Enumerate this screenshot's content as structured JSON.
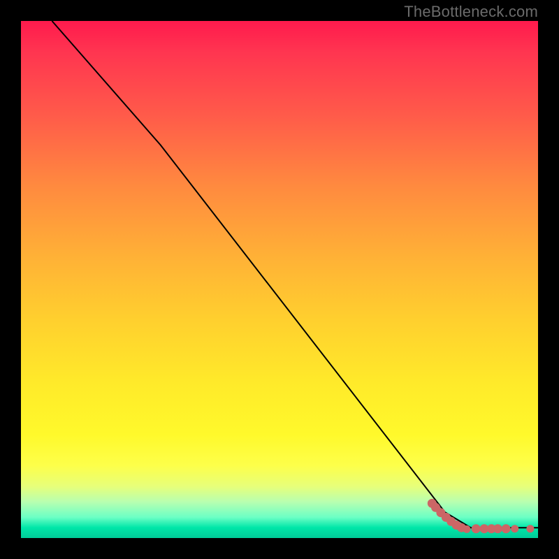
{
  "watermark": "TheBottleneck.com",
  "chart_data": {
    "type": "line",
    "title": "",
    "xlabel": "",
    "ylabel": "",
    "xlim": [
      0,
      1
    ],
    "ylim": [
      0,
      1
    ],
    "series": [
      {
        "name": "curve",
        "points": [
          {
            "x": 0.06,
            "y": 1.0
          },
          {
            "x": 0.27,
            "y": 0.76
          },
          {
            "x": 0.82,
            "y": 0.05
          },
          {
            "x": 0.87,
            "y": 0.02
          },
          {
            "x": 1.0,
            "y": 0.02
          }
        ]
      }
    ],
    "scatter": [
      {
        "x": 0.795,
        "y": 0.067,
        "r": 6
      },
      {
        "x": 0.802,
        "y": 0.059,
        "r": 6
      },
      {
        "x": 0.812,
        "y": 0.049,
        "r": 6
      },
      {
        "x": 0.822,
        "y": 0.04,
        "r": 6
      },
      {
        "x": 0.832,
        "y": 0.032,
        "r": 6
      },
      {
        "x": 0.842,
        "y": 0.025,
        "r": 6
      },
      {
        "x": 0.852,
        "y": 0.02,
        "r": 6
      },
      {
        "x": 0.862,
        "y": 0.017,
        "r": 5
      },
      {
        "x": 0.88,
        "y": 0.018,
        "r": 6
      },
      {
        "x": 0.896,
        "y": 0.018,
        "r": 6
      },
      {
        "x": 0.91,
        "y": 0.018,
        "r": 6
      },
      {
        "x": 0.922,
        "y": 0.018,
        "r": 6
      },
      {
        "x": 0.938,
        "y": 0.018,
        "r": 6
      },
      {
        "x": 0.955,
        "y": 0.018,
        "r": 5
      },
      {
        "x": 0.985,
        "y": 0.018,
        "r": 5
      }
    ],
    "style": {
      "curve_color": "#000000",
      "curve_width": 2,
      "point_fill": "#cc6666",
      "point_stroke": "#cc6666"
    }
  }
}
